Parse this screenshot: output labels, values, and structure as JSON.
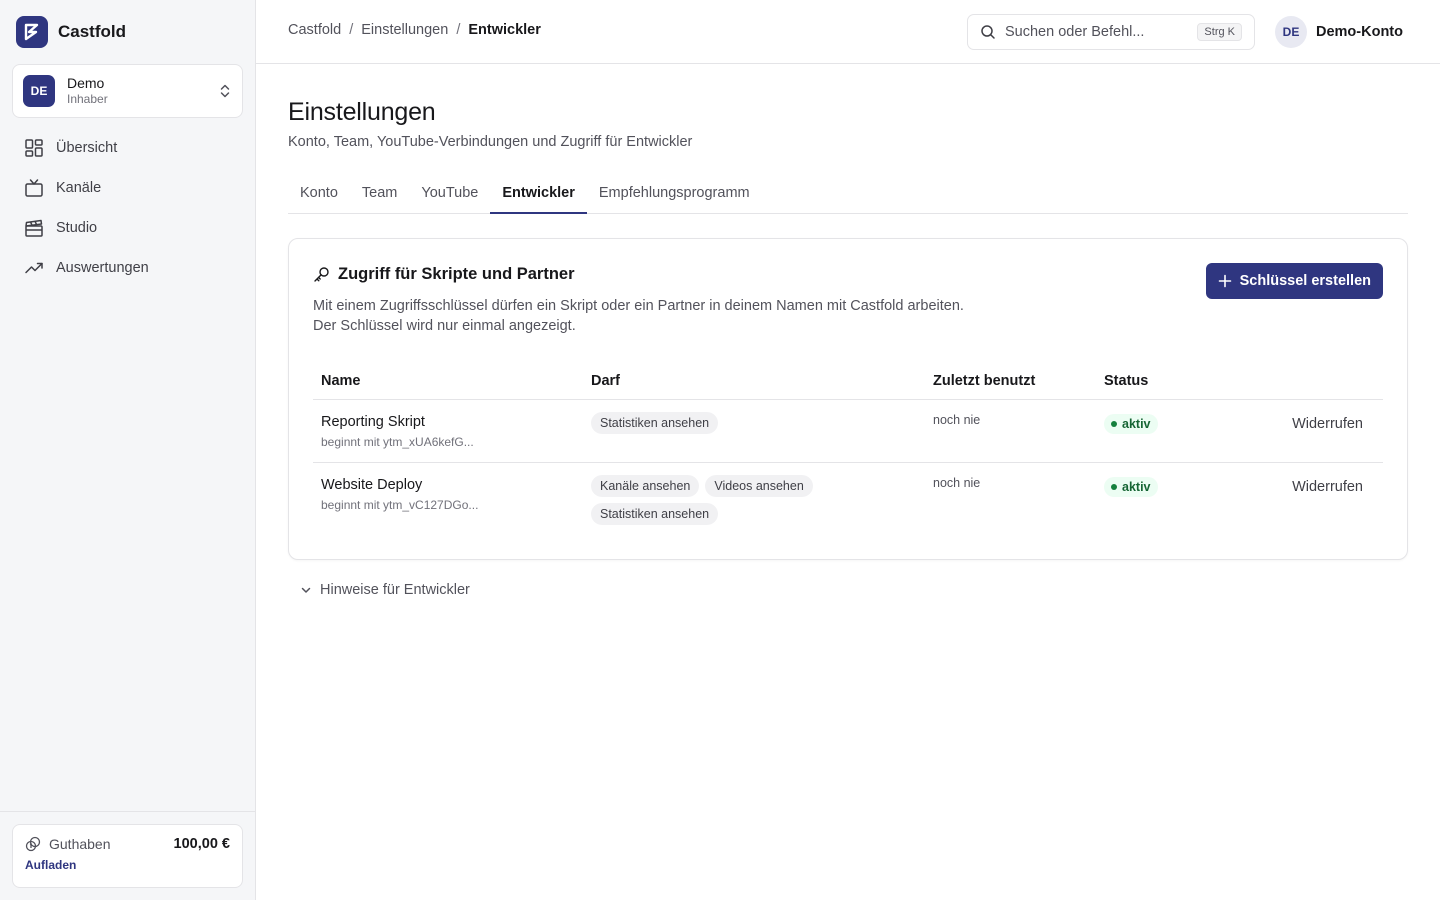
{
  "sidebar": {
    "brand": "Castfold",
    "workspace": {
      "initials": "DE",
      "name": "Demo",
      "role": "Inhaber"
    },
    "items": [
      {
        "label": "Übersicht",
        "icon": "dashboard-icon"
      },
      {
        "label": "Kanäle",
        "icon": "tv-icon"
      },
      {
        "label": "Studio",
        "icon": "clapperboard-icon"
      },
      {
        "label": "Auswertungen",
        "icon": "trending-up-icon"
      }
    ],
    "balance": {
      "label": "Guthaben",
      "amount": "100,00 €",
      "topup": "Aufladen"
    }
  },
  "topbar": {
    "breadcrumb": [
      "Castfold",
      "Einstellungen",
      "Entwickler"
    ],
    "search_placeholder": "Suchen oder Befehl...",
    "shortcut": "Strg K",
    "account": {
      "initials": "DE",
      "name": "Demo-Konto"
    }
  },
  "page": {
    "title": "Einstellungen",
    "subtitle": "Konto, Team, YouTube-Verbindungen und Zugriff für Entwickler",
    "tabs": [
      "Konto",
      "Team",
      "YouTube",
      "Entwickler",
      "Empfehlungsprogramm"
    ],
    "active_tab": "Entwickler"
  },
  "card": {
    "title": "Zugriff für Skripte und Partner",
    "desc_line1": "Mit einem Zugriffsschlüssel dürfen ein Skript oder ein Partner in deinem Namen mit Castfold arbeiten.",
    "desc_line2": "Der Schlüssel wird nur einmal angezeigt.",
    "create_button": "Schlüssel erstellen",
    "columns": {
      "name": "Name",
      "perm": "Darf",
      "last": "Zuletzt benutzt",
      "status": "Status"
    },
    "rows": [
      {
        "name": "Reporting Skript",
        "prefix": "beginnt mit ytm_xUA6kefG...",
        "perms": [
          "Statistiken ansehen"
        ],
        "last_used": "noch nie",
        "status": "aktiv",
        "action": "Widerrufen"
      },
      {
        "name": "Website Deploy",
        "prefix": "beginnt mit ytm_vC127DGo...",
        "perms": [
          "Kanäle ansehen",
          "Videos ansehen",
          "Statistiken ansehen"
        ],
        "last_used": "noch nie",
        "status": "aktiv",
        "action": "Widerrufen"
      }
    ]
  },
  "hints": "Hinweise für Entwickler",
  "colors": {
    "accent": "#2f3680",
    "status_active": "#15803d",
    "sidebar_bg": "#f5f6f8"
  }
}
